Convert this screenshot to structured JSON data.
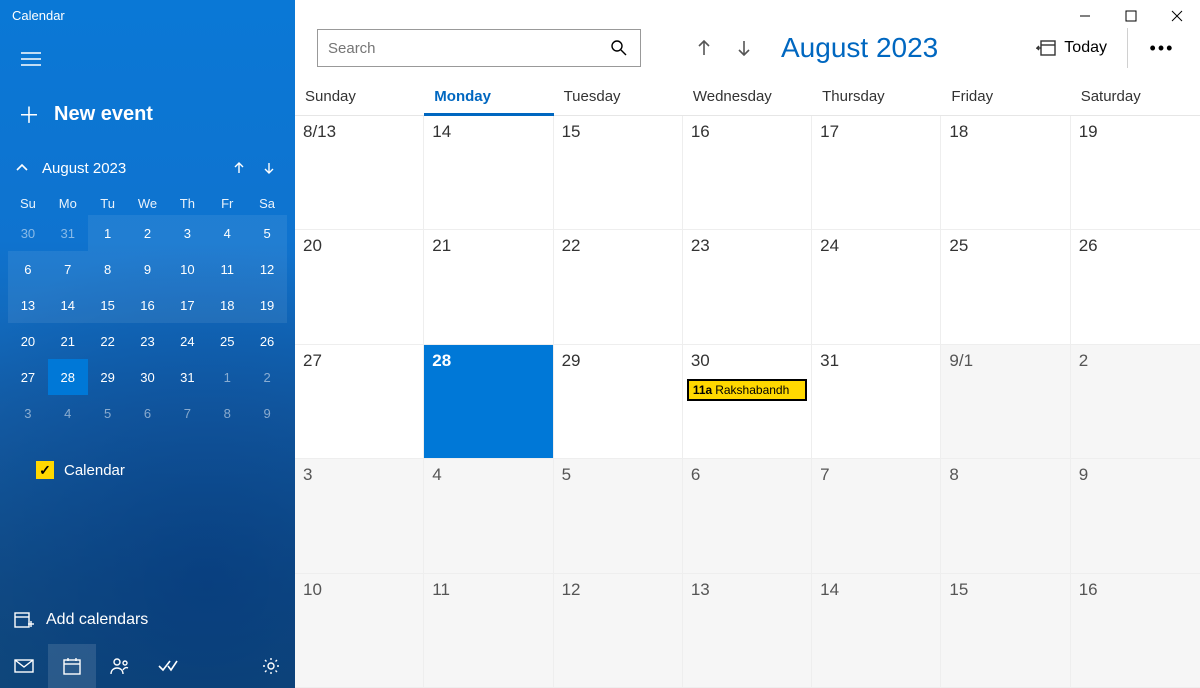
{
  "app": {
    "title": "Calendar"
  },
  "sidebar": {
    "new_event_label": "New event",
    "mini_month_label": "August 2023",
    "dow": [
      "Su",
      "Mo",
      "Tu",
      "We",
      "Th",
      "Fr",
      "Sa"
    ],
    "mini_weeks": [
      [
        {
          "d": "30",
          "dim": true
        },
        {
          "d": "31",
          "dim": true
        },
        {
          "d": "1",
          "bg": true
        },
        {
          "d": "2",
          "bg": true
        },
        {
          "d": "3",
          "bg": true
        },
        {
          "d": "4",
          "bg": true
        },
        {
          "d": "5",
          "bg": true
        }
      ],
      [
        {
          "d": "6",
          "bg": true
        },
        {
          "d": "7",
          "bg": true
        },
        {
          "d": "8",
          "bg": true
        },
        {
          "d": "9",
          "bg": true
        },
        {
          "d": "10",
          "bg": true
        },
        {
          "d": "11",
          "bg": true
        },
        {
          "d": "12",
          "bg": true
        }
      ],
      [
        {
          "d": "13",
          "bg": true
        },
        {
          "d": "14",
          "bg": true
        },
        {
          "d": "15",
          "bg": true
        },
        {
          "d": "16",
          "bg": true
        },
        {
          "d": "17",
          "bg": true
        },
        {
          "d": "18",
          "bg": true
        },
        {
          "d": "19",
          "bg": true
        }
      ],
      [
        {
          "d": "20"
        },
        {
          "d": "21"
        },
        {
          "d": "22"
        },
        {
          "d": "23"
        },
        {
          "d": "24"
        },
        {
          "d": "25"
        },
        {
          "d": "26"
        }
      ],
      [
        {
          "d": "27"
        },
        {
          "d": "28",
          "selected": true
        },
        {
          "d": "29"
        },
        {
          "d": "30"
        },
        {
          "d": "31"
        },
        {
          "d": "1",
          "dim": true
        },
        {
          "d": "2",
          "dim": true
        }
      ],
      [
        {
          "d": "3",
          "dim": true
        },
        {
          "d": "4",
          "dim": true
        },
        {
          "d": "5",
          "dim": true
        },
        {
          "d": "6",
          "dim": true
        },
        {
          "d": "7",
          "dim": true
        },
        {
          "d": "8",
          "dim": true
        },
        {
          "d": "9",
          "dim": true
        }
      ]
    ],
    "calendar_checkbox_label": "Calendar",
    "add_calendars_label": "Add calendars"
  },
  "toolbar": {
    "search_placeholder": "Search",
    "month_label": "August 2023",
    "today_label": "Today"
  },
  "dow_full": [
    "Sunday",
    "Monday",
    "Tuesday",
    "Wednesday",
    "Thursday",
    "Friday",
    "Saturday"
  ],
  "active_dow_index": 1,
  "grid_weeks": [
    [
      {
        "d": "8/13"
      },
      {
        "d": "14"
      },
      {
        "d": "15"
      },
      {
        "d": "16"
      },
      {
        "d": "17"
      },
      {
        "d": "18"
      },
      {
        "d": "19"
      }
    ],
    [
      {
        "d": "20"
      },
      {
        "d": "21"
      },
      {
        "d": "22"
      },
      {
        "d": "23"
      },
      {
        "d": "24"
      },
      {
        "d": "25"
      },
      {
        "d": "26"
      }
    ],
    [
      {
        "d": "27"
      },
      {
        "d": "28",
        "selected": true
      },
      {
        "d": "29"
      },
      {
        "d": "30",
        "event": {
          "time": "11a",
          "title": "Rakshabandh"
        }
      },
      {
        "d": "31"
      },
      {
        "d": "9/1",
        "other": true
      },
      {
        "d": "2",
        "other": true
      }
    ],
    [
      {
        "d": "3",
        "other": true
      },
      {
        "d": "4",
        "other": true
      },
      {
        "d": "5",
        "other": true
      },
      {
        "d": "6",
        "other": true
      },
      {
        "d": "7",
        "other": true
      },
      {
        "d": "8",
        "other": true
      },
      {
        "d": "9",
        "other": true
      }
    ],
    [
      {
        "d": "10",
        "other": true
      },
      {
        "d": "11",
        "other": true
      },
      {
        "d": "12",
        "other": true
      },
      {
        "d": "13",
        "other": true
      },
      {
        "d": "14",
        "other": true
      },
      {
        "d": "15",
        "other": true
      },
      {
        "d": "16",
        "other": true
      }
    ]
  ]
}
